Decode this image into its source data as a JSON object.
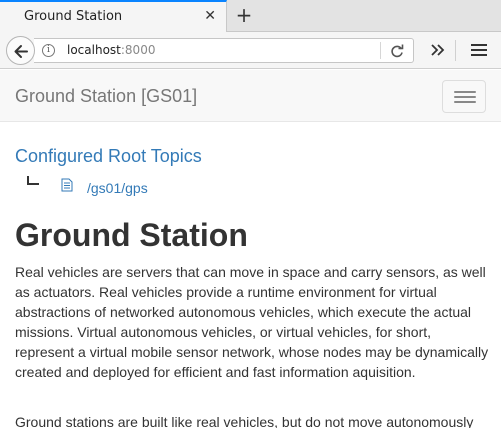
{
  "browser": {
    "tab_title": "Ground Station",
    "tab_close": "✕",
    "new_tab": "+",
    "url_host": "localhost",
    "url_port": ":8000"
  },
  "site": {
    "brand": "Ground Station [GS01]"
  },
  "topics": {
    "heading": "Configured Root Topics",
    "items": [
      "/gs01/gps"
    ]
  },
  "main": {
    "title": "Ground Station",
    "paragraphs": [
      "Real vehicles are servers that can move in space and carry sensors, as well as actuators. Real vehicles provide a runtime environment for virtual abstractions of networked autonomous vehicles, which execute the actual missions. Virtual autonomous vehicles, or virtual vehicles, for short, represent a virtual mobile sensor network, whose nodes may be dynamically created and deployed for efficient and fast information aquisition.",
      "Ground stations are built like real vehicles, but do not move autonomously"
    ]
  },
  "colors": {
    "link": "#337ab7",
    "text": "#333333",
    "tab_accent": "#0a84ff"
  }
}
